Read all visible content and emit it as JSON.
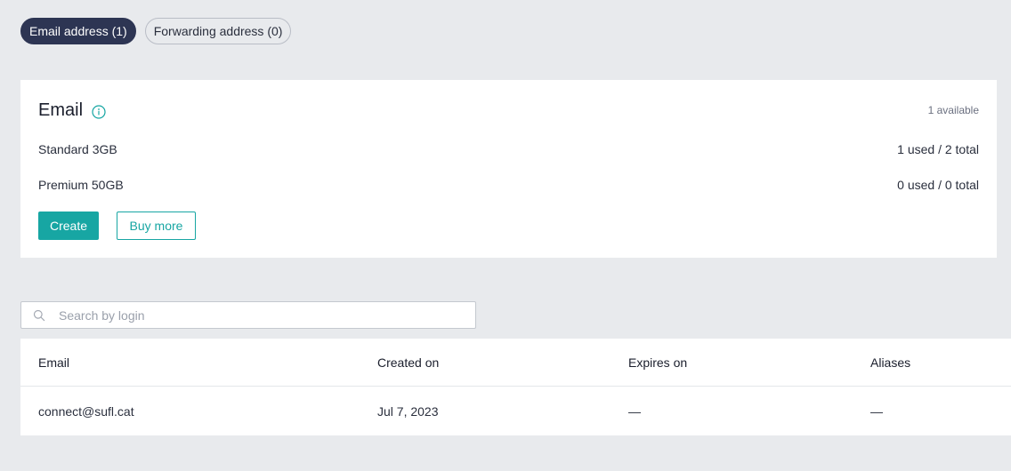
{
  "tabs": [
    {
      "label": "Email address (1)",
      "active": true
    },
    {
      "label": "Forwarding address (0)",
      "active": false
    }
  ],
  "email_card": {
    "title": "Email",
    "available": "1 available",
    "plans": [
      {
        "name": "Standard 3GB",
        "usage": "1 used / 2 total"
      },
      {
        "name": "Premium 50GB",
        "usage": "0 used / 0 total"
      }
    ],
    "create_label": "Create",
    "buy_more_label": "Buy more"
  },
  "search": {
    "placeholder": "Search by login",
    "value": ""
  },
  "table": {
    "columns": [
      "Email",
      "Created on",
      "Expires on",
      "Aliases"
    ],
    "rows": [
      [
        "connect@sufl.cat",
        "Jul 7, 2023",
        "—",
        "—"
      ]
    ]
  },
  "colors": {
    "accent": "#17a6a3",
    "active_tab": "#2d3553",
    "background": "#e8eaed"
  },
  "icons": {
    "info": "info-circle-icon",
    "search": "search-icon"
  }
}
